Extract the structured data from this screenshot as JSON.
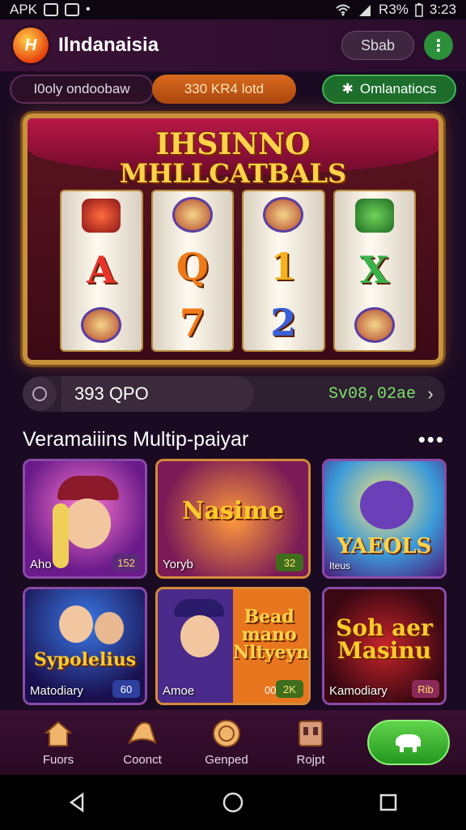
{
  "status_bar": {
    "carrier": "APK",
    "battery": "R3%",
    "time": "3:23"
  },
  "app": {
    "name": "Ilndanaisia",
    "logo_text": "H"
  },
  "header": {
    "signin_label": "Sbab",
    "menu_icon": "kebab-menu-icon"
  },
  "tabs": [
    {
      "label": "I0oly ondoobaw"
    },
    {
      "label": "330 KR4 lotd"
    },
    {
      "label": "Omlanatiocs"
    }
  ],
  "banner": {
    "title_line1": "IHSINNO",
    "title_line2": "MHLLCATBALS",
    "reel_symbols": [
      "A",
      "Q",
      "1",
      "X",
      "7",
      "2"
    ]
  },
  "balance": {
    "amount": "393 QPO",
    "coins": "Sv08,02ae"
  },
  "section": {
    "title": "Veramaiiins Multip-paiyar",
    "more": "•••"
  },
  "games": [
    {
      "name": "Aho",
      "badge": "152",
      "logo": ""
    },
    {
      "name": "Yoryb",
      "badge": "32",
      "logo": "Nasime"
    },
    {
      "name": "Iteus",
      "badge": "",
      "logo": "YAEOLS"
    },
    {
      "name": "Matodiary",
      "badge": "60",
      "logo": "Sypolelius"
    },
    {
      "name": "Amoe",
      "badge": "2K",
      "extra": "00",
      "logo": "Bead mano Nltyeyn"
    },
    {
      "name": "Kamodiary",
      "badge": "Rib",
      "logo": "Soh aer Masinu"
    }
  ],
  "bottom_nav": [
    {
      "label": "Fuors",
      "icon": "home-icon"
    },
    {
      "label": "Coonct",
      "icon": "hat-icon"
    },
    {
      "label": "Genped",
      "icon": "coin-icon"
    },
    {
      "label": "Rojpt",
      "icon": "slot-machine-icon"
    }
  ],
  "play_icon": "piggy-bank-icon",
  "colors": {
    "accent_green": "#2c8f3a",
    "accent_orange": "#d96b1e",
    "gold": "#ffd24a",
    "background": "#1a0b22"
  }
}
